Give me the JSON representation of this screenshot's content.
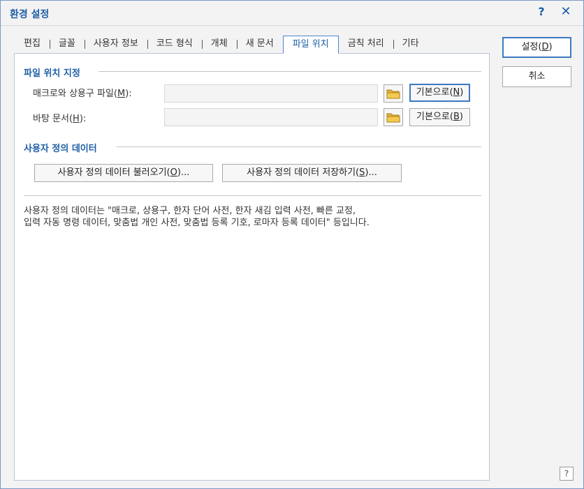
{
  "window": {
    "title": "환경 설정",
    "help_glyph": "?",
    "close_glyph": "✕"
  },
  "tabs": [
    {
      "label": "편집",
      "active": false
    },
    {
      "label": "글꼴",
      "active": false
    },
    {
      "label": "사용자 정보",
      "active": false
    },
    {
      "label": "코드 형식",
      "active": false
    },
    {
      "label": "개체",
      "active": false
    },
    {
      "label": "새 문서",
      "active": false
    },
    {
      "label": "파일 위치",
      "active": true
    },
    {
      "label": "금칙 처리",
      "active": false
    },
    {
      "label": "기타",
      "active": false
    }
  ],
  "file_location": {
    "section_title": "파일 위치 지정",
    "macro": {
      "label_prefix": "매크로와 상용구 파일(",
      "label_key": "M",
      "label_suffix": "):",
      "value": "",
      "default_prefix": "기본으로(",
      "default_key": "N",
      "default_suffix": ")"
    },
    "background": {
      "label_prefix": "바탕 문서(",
      "label_key": "H",
      "label_suffix": "):",
      "value": "",
      "default_prefix": "기본으로(",
      "default_key": "B",
      "default_suffix": ")"
    }
  },
  "user_data": {
    "section_title": "사용자 정의 데이터",
    "load_prefix": "사용자 정의 데이터 불러오기(",
    "load_key": "O",
    "load_suffix": ")...",
    "save_prefix": "사용자 정의 데이터 저장하기(",
    "save_key": "S",
    "save_suffix": ")..."
  },
  "description": "사용자 정의 데이터는 \"매크로, 상용구, 한자 단어 사전, 한자 새김 입력 사전, 빠른 교정,\n입력 자동 명령 데이터, 맞춤법 개인 사전, 맞춤법 등록 기호, 로마자 등록 데이터\" 등입니다.",
  "side_buttons": {
    "ok_prefix": "설정(",
    "ok_key": "D",
    "ok_suffix": ")",
    "cancel_label": "취소"
  },
  "corner_help": "?",
  "colors": {
    "accent": "#1f5fa8",
    "focus_border": "#3d78c2"
  },
  "icons": {
    "folder": "folder-icon"
  }
}
